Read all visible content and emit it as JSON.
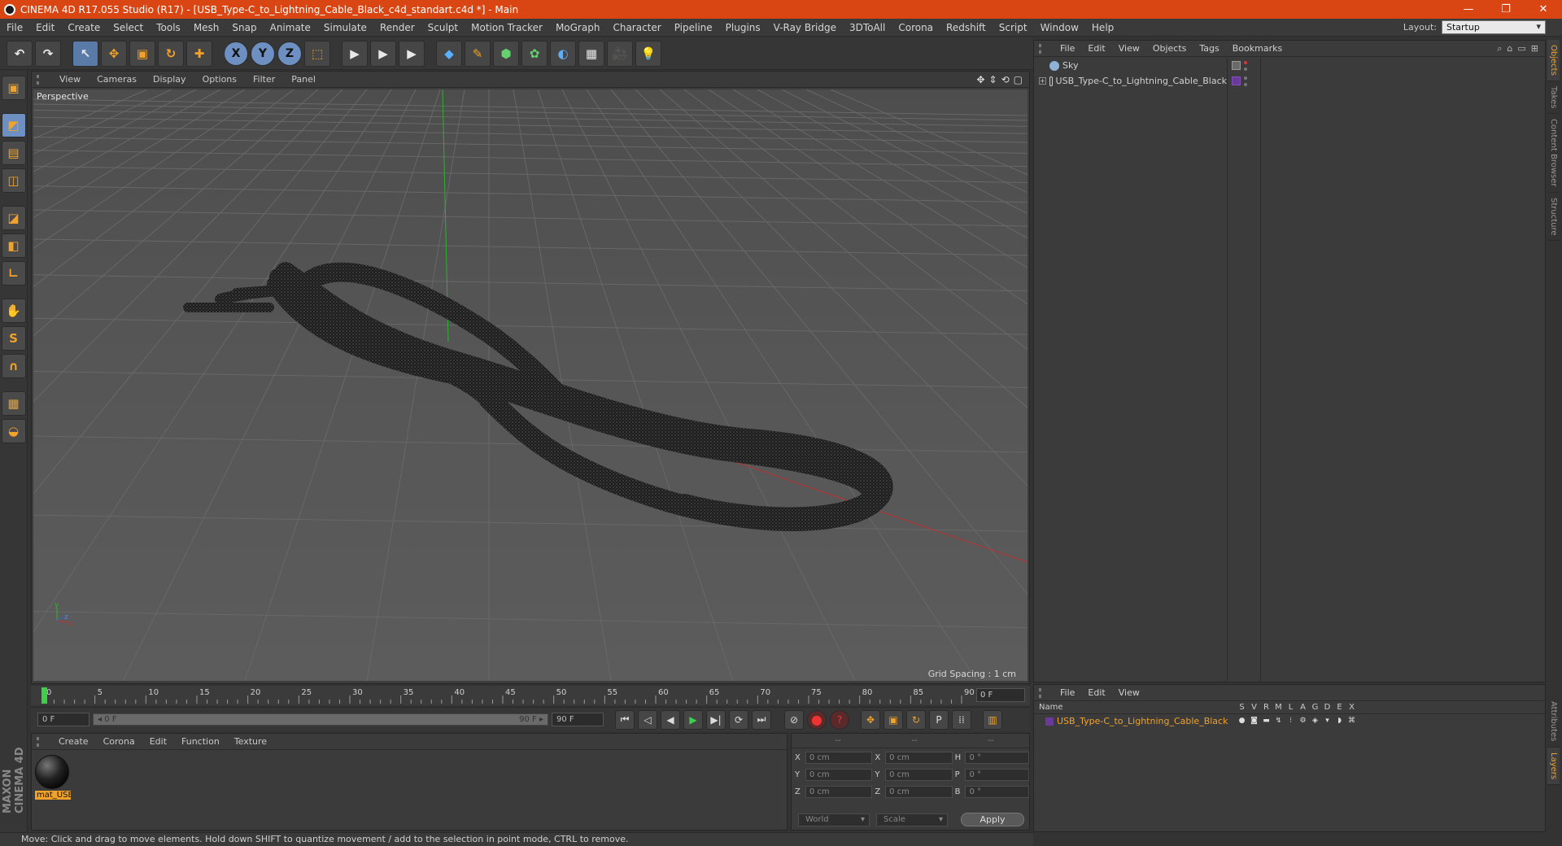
{
  "titlebar": {
    "title": "CINEMA 4D R17.055 Studio (R17) - [USB_Type-C_to_Lightning_Cable_Black_c4d_standart.c4d *] - Main",
    "minimize": "—",
    "maximize": "❐",
    "close": "✕"
  },
  "menubar": {
    "items": [
      "File",
      "Edit",
      "Create",
      "Select",
      "Tools",
      "Mesh",
      "Snap",
      "Animate",
      "Simulate",
      "Render",
      "Sculpt",
      "Motion Tracker",
      "MoGraph",
      "Character",
      "Pipeline",
      "Plugins",
      "V-Ray Bridge",
      "3DToAll",
      "Corona",
      "Redshift",
      "Script",
      "Window",
      "Help"
    ],
    "layout_label": "Layout:",
    "layout_value": "Startup"
  },
  "toolbar": {
    "undo": "↶",
    "redo": "↷",
    "select": "↖",
    "move": "✥",
    "scale": "▣",
    "rotate": "↻",
    "add": "✚",
    "axis_x": "X",
    "axis_y": "Y",
    "axis_z": "Z",
    "coord": "⬚",
    "render_view": "▶",
    "render_pic": "▶",
    "render_settings": "▶",
    "cube": "◆",
    "pen": "✎",
    "subdivide": "⬢",
    "array": "✿",
    "deform": "◐",
    "floor": "▦",
    "camera": "🎥",
    "light": "💡"
  },
  "leftbar": {
    "tools": [
      "▣",
      "◩",
      "▤",
      "◫",
      "◪",
      "◧",
      "∟",
      "✋",
      "S",
      "∩",
      "▦",
      "◒"
    ]
  },
  "brand": {
    "maxon": "MAXON",
    "product": "CINEMA 4D"
  },
  "viewport": {
    "menus": [
      "View",
      "Cameras",
      "Display",
      "Options",
      "Filter",
      "Panel"
    ],
    "nav_icons": [
      "✥",
      "⇕",
      "⟲",
      "▢"
    ],
    "label": "Perspective",
    "grid_spacing": "Grid Spacing : 1 cm",
    "axis_labels": [
      "y",
      "z",
      "x"
    ]
  },
  "timeline": {
    "ticks": [
      0,
      5,
      10,
      15,
      20,
      25,
      30,
      35,
      40,
      45,
      50,
      55,
      60,
      65,
      70,
      75,
      80,
      85,
      90
    ],
    "max_frame": 90,
    "current_frame": "0 F"
  },
  "transport": {
    "start_field": "0 F",
    "slider_left": "◂ 0 F",
    "slider_right": "90 F ▸",
    "end_field": "90 F",
    "buttons": [
      "⏮",
      "◁",
      "◀",
      "▶",
      "▶|",
      "⟳",
      "⏭"
    ],
    "key_buttons": [
      "⊘",
      "⬤",
      "?",
      "✥",
      "▣",
      "↻",
      "P",
      "⁞⁞",
      "▥"
    ]
  },
  "material_manager": {
    "menus": [
      "Create",
      "Corona",
      "Edit",
      "Function",
      "Texture"
    ],
    "material_name": "mat_USB"
  },
  "coordinates": {
    "header": [
      "--",
      "--",
      "--"
    ],
    "rows": [
      {
        "a": "X",
        "v1": "0 cm",
        "b": "X",
        "v2": "0 cm",
        "c": "H",
        "v3": "0 °"
      },
      {
        "a": "Y",
        "v1": "0 cm",
        "b": "Y",
        "v2": "0 cm",
        "c": "P",
        "v3": "0 °"
      },
      {
        "a": "Z",
        "v1": "0 cm",
        "b": "Z",
        "v2": "0 cm",
        "c": "B",
        "v3": "0 °"
      }
    ],
    "space": "World",
    "mode": "Scale",
    "apply": "Apply"
  },
  "object_manager": {
    "menus": [
      "File",
      "Edit",
      "View",
      "Objects",
      "Tags",
      "Bookmarks"
    ],
    "tools": [
      "⌕",
      "⌂",
      "▭",
      "⊞"
    ],
    "objects": [
      {
        "name": "Sky",
        "expand": "",
        "icon": "sky"
      },
      {
        "name": "USB_Type-C_to_Lightning_Cable_Black",
        "expand": "+",
        "icon": "null"
      }
    ]
  },
  "side_tabs": [
    "Objects",
    "Takes",
    "Content Browser",
    "Structure",
    "Attributes",
    "Layers"
  ],
  "layer_manager": {
    "menus": [
      "File",
      "Edit",
      "View"
    ],
    "header_name": "Name",
    "columns": [
      "S",
      "V",
      "R",
      "M",
      "L",
      "A",
      "G",
      "D",
      "E",
      "X"
    ],
    "layer_name": "USB_Type-C_to_Lightning_Cable_Black",
    "layer_icons": [
      "●",
      "◙",
      "▬",
      "↯",
      "⁝",
      "⚙",
      "◈",
      "▾",
      "◗",
      "⌘"
    ]
  },
  "status": {
    "text": "Move: Click and drag to move elements. Hold down SHIFT to quantize movement / add to the selection in point mode, CTRL to remove."
  },
  "colors": {
    "titlebar": "#d94614",
    "accent": "#f0a22a",
    "x_axis": "#c03030",
    "y_axis": "#30b030"
  }
}
